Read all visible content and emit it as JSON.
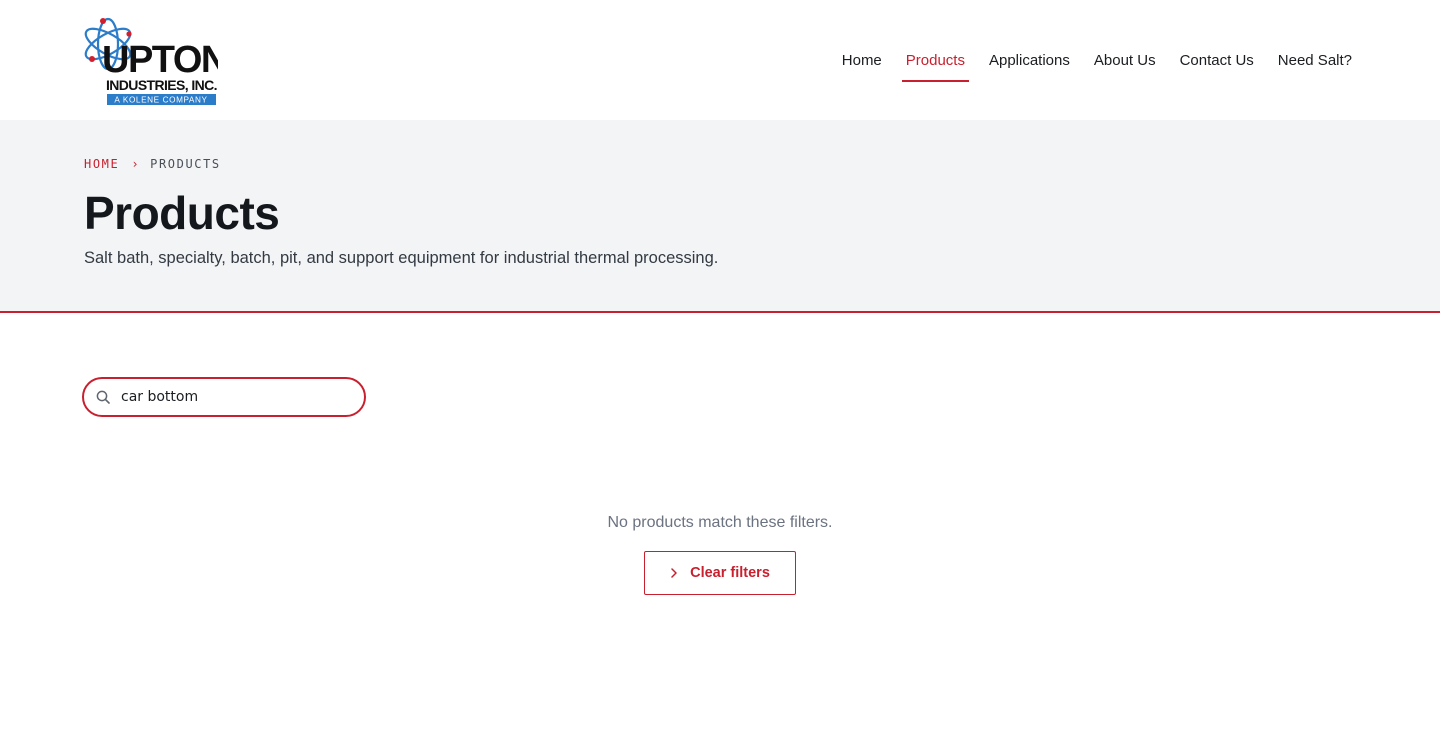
{
  "brand": {
    "logo_main": "UPTON",
    "logo_sub": "INDUSTRIES, INC.",
    "logo_tag": "A KOLENE COMPANY"
  },
  "nav": {
    "items": [
      {
        "label": "Home",
        "active": false
      },
      {
        "label": "Products",
        "active": true
      },
      {
        "label": "Applications",
        "active": false
      },
      {
        "label": "About Us",
        "active": false
      },
      {
        "label": "Contact Us",
        "active": false
      },
      {
        "label": "Need Salt?",
        "active": false
      }
    ]
  },
  "breadcrumb": {
    "home": "HOME",
    "separator": "›",
    "current": "PRODUCTS"
  },
  "hero": {
    "title": "Products",
    "subtitle": "Salt bath, specialty, batch, pit, and support equipment for industrial thermal processing."
  },
  "search": {
    "value": "car bottom",
    "icon": "search-icon"
  },
  "empty_state": {
    "message": "No products match these filters.",
    "button_label": "Clear filters",
    "button_icon": "chevron-right-icon"
  },
  "colors": {
    "accent": "#c8202f",
    "hero_bg": "#f3f4f6",
    "text": "#1a1d21",
    "muted": "#6b7280",
    "logo_blue": "#2b7cc9"
  }
}
